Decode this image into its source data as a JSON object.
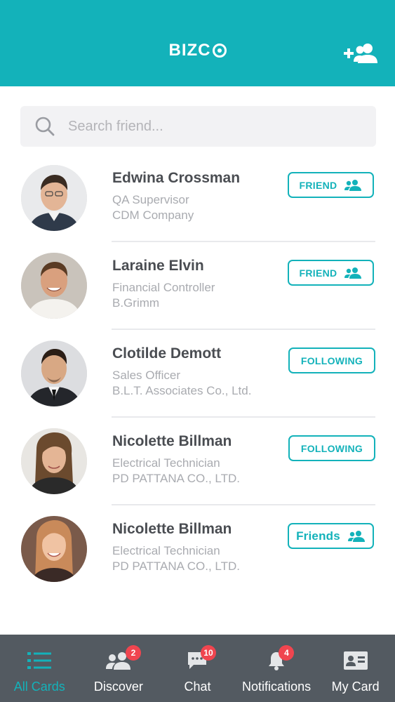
{
  "app": {
    "logo_text": "BIZC",
    "accent_color": "#13b2ba",
    "add_friend_icon": "add-person-icon"
  },
  "search": {
    "placeholder": "Search friend...",
    "value": ""
  },
  "contacts": [
    {
      "name": "Edwina Crossman",
      "title": "QA Supervisor",
      "company": "CDM Company",
      "action": "FRIEND",
      "action_icon": "people-icon"
    },
    {
      "name": "Laraine Elvin",
      "title": "Financial Controller",
      "company": "B.Grimm",
      "action": "FRIEND",
      "action_icon": "people-icon"
    },
    {
      "name": "Clotilde Demott",
      "title": "Sales Officer",
      "company": "B.L.T. Associates Co., Ltd.",
      "action": "FOLLOWING"
    },
    {
      "name": "Nicolette Billman",
      "title": "Electrical Technician",
      "company": "PD PATTANA CO., LTD.",
      "action": "FOLLOWING"
    },
    {
      "name": "Nicolette Billman",
      "title": "Electrical Technician",
      "company": "PD PATTANA CO., LTD.",
      "action": "Friends",
      "action_icon": "people-icon"
    }
  ],
  "tabs": [
    {
      "label": "All Cards",
      "icon": "list-icon",
      "active": true
    },
    {
      "label": "Discover",
      "icon": "people-icon",
      "badge": "2"
    },
    {
      "label": "Chat",
      "icon": "chat-icon",
      "badge": "10"
    },
    {
      "label": "Notifications",
      "icon": "bell-icon",
      "badge": "4"
    },
    {
      "label": "My Card",
      "icon": "id-card-icon"
    }
  ],
  "colors": {
    "header_bg": "#13b2ba",
    "tabbar_bg": "#535a61",
    "badge_bg": "#f0454f"
  }
}
